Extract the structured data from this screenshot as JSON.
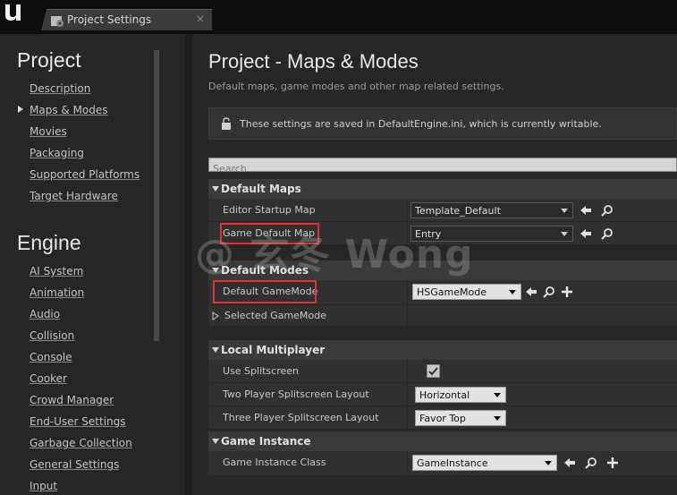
{
  "window": {
    "tab_title": "Project Settings",
    "close_glyph": "×"
  },
  "sidebar": {
    "project_title": "Project",
    "project_items": [
      "Description",
      "Maps & Modes",
      "Movies",
      "Packaging",
      "Supported Platforms",
      "Target Hardware"
    ],
    "selected_item": "Maps & Modes",
    "engine_title": "Engine",
    "engine_items": [
      "AI System",
      "Animation",
      "Audio",
      "Collision",
      "Console",
      "Cooker",
      "Crowd Manager",
      "End-User Settings",
      "Garbage Collection",
      "General Settings",
      "Input"
    ]
  },
  "main": {
    "title": "Project - Maps & Modes",
    "subtitle": "Default maps, game modes and other map related settings.",
    "notice": "These settings are saved in DefaultEngine.ini, which is currently writable.",
    "search_placeholder": "Search",
    "default_maps": {
      "label": "Default Maps",
      "editor_startup_map": {
        "label": "Editor Startup Map",
        "value": "Template_Default"
      },
      "game_default_map": {
        "label": "Game Default Map",
        "value": "Entry"
      }
    },
    "default_modes": {
      "label": "Default Modes",
      "default_gamemode": {
        "label": "Default GameMode",
        "value": "HSGameMode"
      },
      "selected_gamemode": {
        "label": "Selected GameMode"
      }
    },
    "local_multiplayer": {
      "label": "Local Multiplayer",
      "use_splitscreen": {
        "label": "Use Splitscreen",
        "checked": true
      },
      "two_player": {
        "label": "Two Player Splitscreen Layout",
        "value": "Horizontal"
      },
      "three_player": {
        "label": "Three Player Splitscreen Layout",
        "value": "Favor Top"
      }
    },
    "game_instance": {
      "label": "Game Instance",
      "class": {
        "label": "Game Instance Class",
        "value": "GameInstance"
      }
    }
  },
  "watermark": "@ 玄冬 Wong",
  "icons": {
    "back": "arrow-left-icon",
    "browse": "magnifier-icon",
    "add": "plus-icon",
    "lock": "lock-icon",
    "logo": "unreal-logo-icon"
  },
  "colors": {
    "highlight": "#e03030",
    "panel": "#262626",
    "row": "#303030",
    "category": "#3a3a3a"
  }
}
